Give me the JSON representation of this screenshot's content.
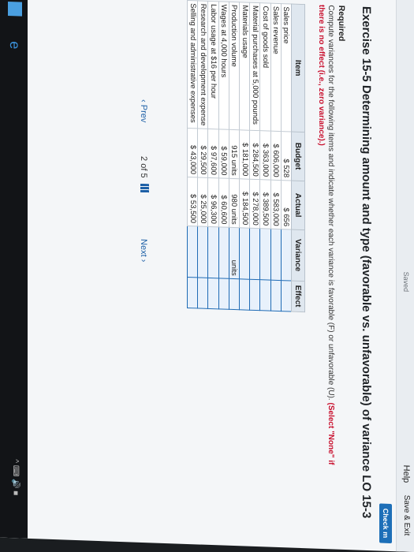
{
  "header": {
    "saved": "Saved",
    "help": "Help",
    "save_exit": "Save & Exit",
    "check": "Check m"
  },
  "title": "Exercise 15-5 Determining amount and type (favorable vs. unfavorable) of variance LO 15-3",
  "required": "Required",
  "instructions_plain": "Compute variances for the following items and indicate whether each variance is favorable (F) or unfavorable (U).",
  "instructions_red": "(Select \"None\" if",
  "instructions_red2": "there is no effect (i.e., zero variance).)",
  "table": {
    "headers": {
      "item": "Item",
      "budget": "Budget",
      "actual": "Actual",
      "variance": "Variance",
      "effect": "Effect"
    },
    "rows": [
      {
        "item": "Sales price",
        "budget": "$ 528",
        "actual": "$ 656"
      },
      {
        "item": "Sales revenue",
        "budget": "$ 606,000",
        "actual": "$ 583,000"
      },
      {
        "item": "Cost of goods sold",
        "budget": "$ 363,000",
        "actual": "$ 389,500"
      },
      {
        "item": "Material purchases at 5,000 pounds",
        "budget": "$ 284,500",
        "actual": "$ 278,000"
      },
      {
        "item": "Materials usage",
        "budget": "$ 181,000",
        "actual": "$ 184,500"
      },
      {
        "item": "Production volume",
        "budget": "915 units",
        "actual": "980 units",
        "variance_unit": "units"
      },
      {
        "item": "Wages at 4,000 hours",
        "budget": "$ 59,000",
        "actual": "$ 60,600"
      },
      {
        "item": "Labor usage at $16 per hour",
        "budget": "$ 97,600",
        "actual": "$ 96,300"
      },
      {
        "item": "Research and development expense",
        "budget": "$ 29,500",
        "actual": "$ 25,000"
      },
      {
        "item": "Selling and administrative expenses",
        "budget": "$ 43,000",
        "actual": "$ 53,500"
      }
    ]
  },
  "nav": {
    "prev": "‹ Prev",
    "page": "2 of 5",
    "next": "Next ›"
  },
  "taskbar": {
    "tray": "^ ⌨ 🔊 ■"
  }
}
